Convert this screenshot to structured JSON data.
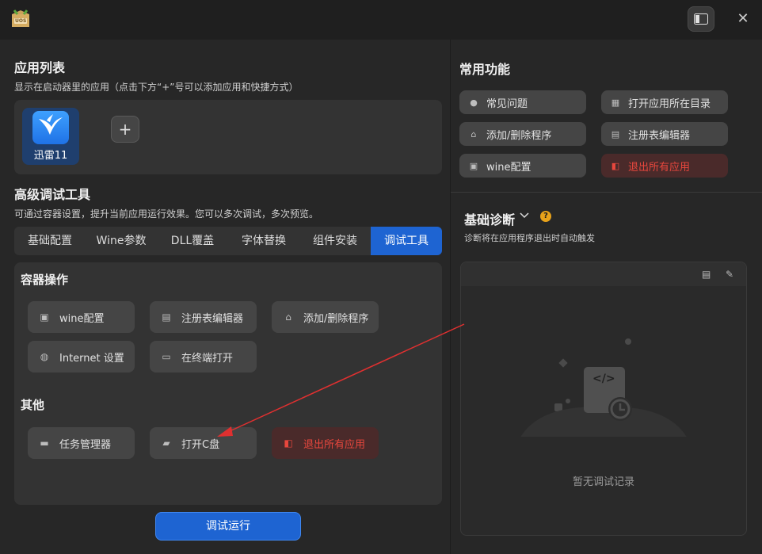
{
  "titlebar": {
    "logo_text": "UOS"
  },
  "app_list": {
    "title": "应用列表",
    "desc": "显示在启动器里的应用（点击下方“+”号可以添加应用和快捷方式）",
    "apps": [
      {
        "label": "迅雷11"
      }
    ],
    "add_label": "+"
  },
  "advanced": {
    "title": "高级调试工具",
    "desc": "可通过容器设置，提升当前应用运行效果。您可以多次调试，多次预览。",
    "tabs": [
      "基础配置",
      "Wine参数",
      "DLL覆盖",
      "字体替换",
      "组件安装",
      "调试工具"
    ],
    "active_tab": "调试工具"
  },
  "container_ops": {
    "title": "容器操作",
    "buttons": [
      "wine配置",
      "注册表编辑器",
      "添加/删除程序",
      "Internet 设置",
      "在终端打开"
    ]
  },
  "other": {
    "title": "其他",
    "buttons": [
      "任务管理器",
      "打开C盘",
      "退出所有应用"
    ]
  },
  "run_label": "调试运行",
  "common": {
    "title": "常用功能",
    "buttons": [
      "常见问题",
      "打开应用所在目录",
      "添加/删除程序",
      "注册表编辑器",
      "wine配置",
      "退出所有应用"
    ]
  },
  "diagnosis": {
    "title": "基础诊断",
    "desc": "诊断将在应用程序退出时自动触发",
    "empty_text": "暂无调试记录",
    "code_glyph": "</>"
  },
  "colors": {
    "accent": "#1e64d2",
    "danger": "#e8473d",
    "arrow": "#e03030"
  }
}
